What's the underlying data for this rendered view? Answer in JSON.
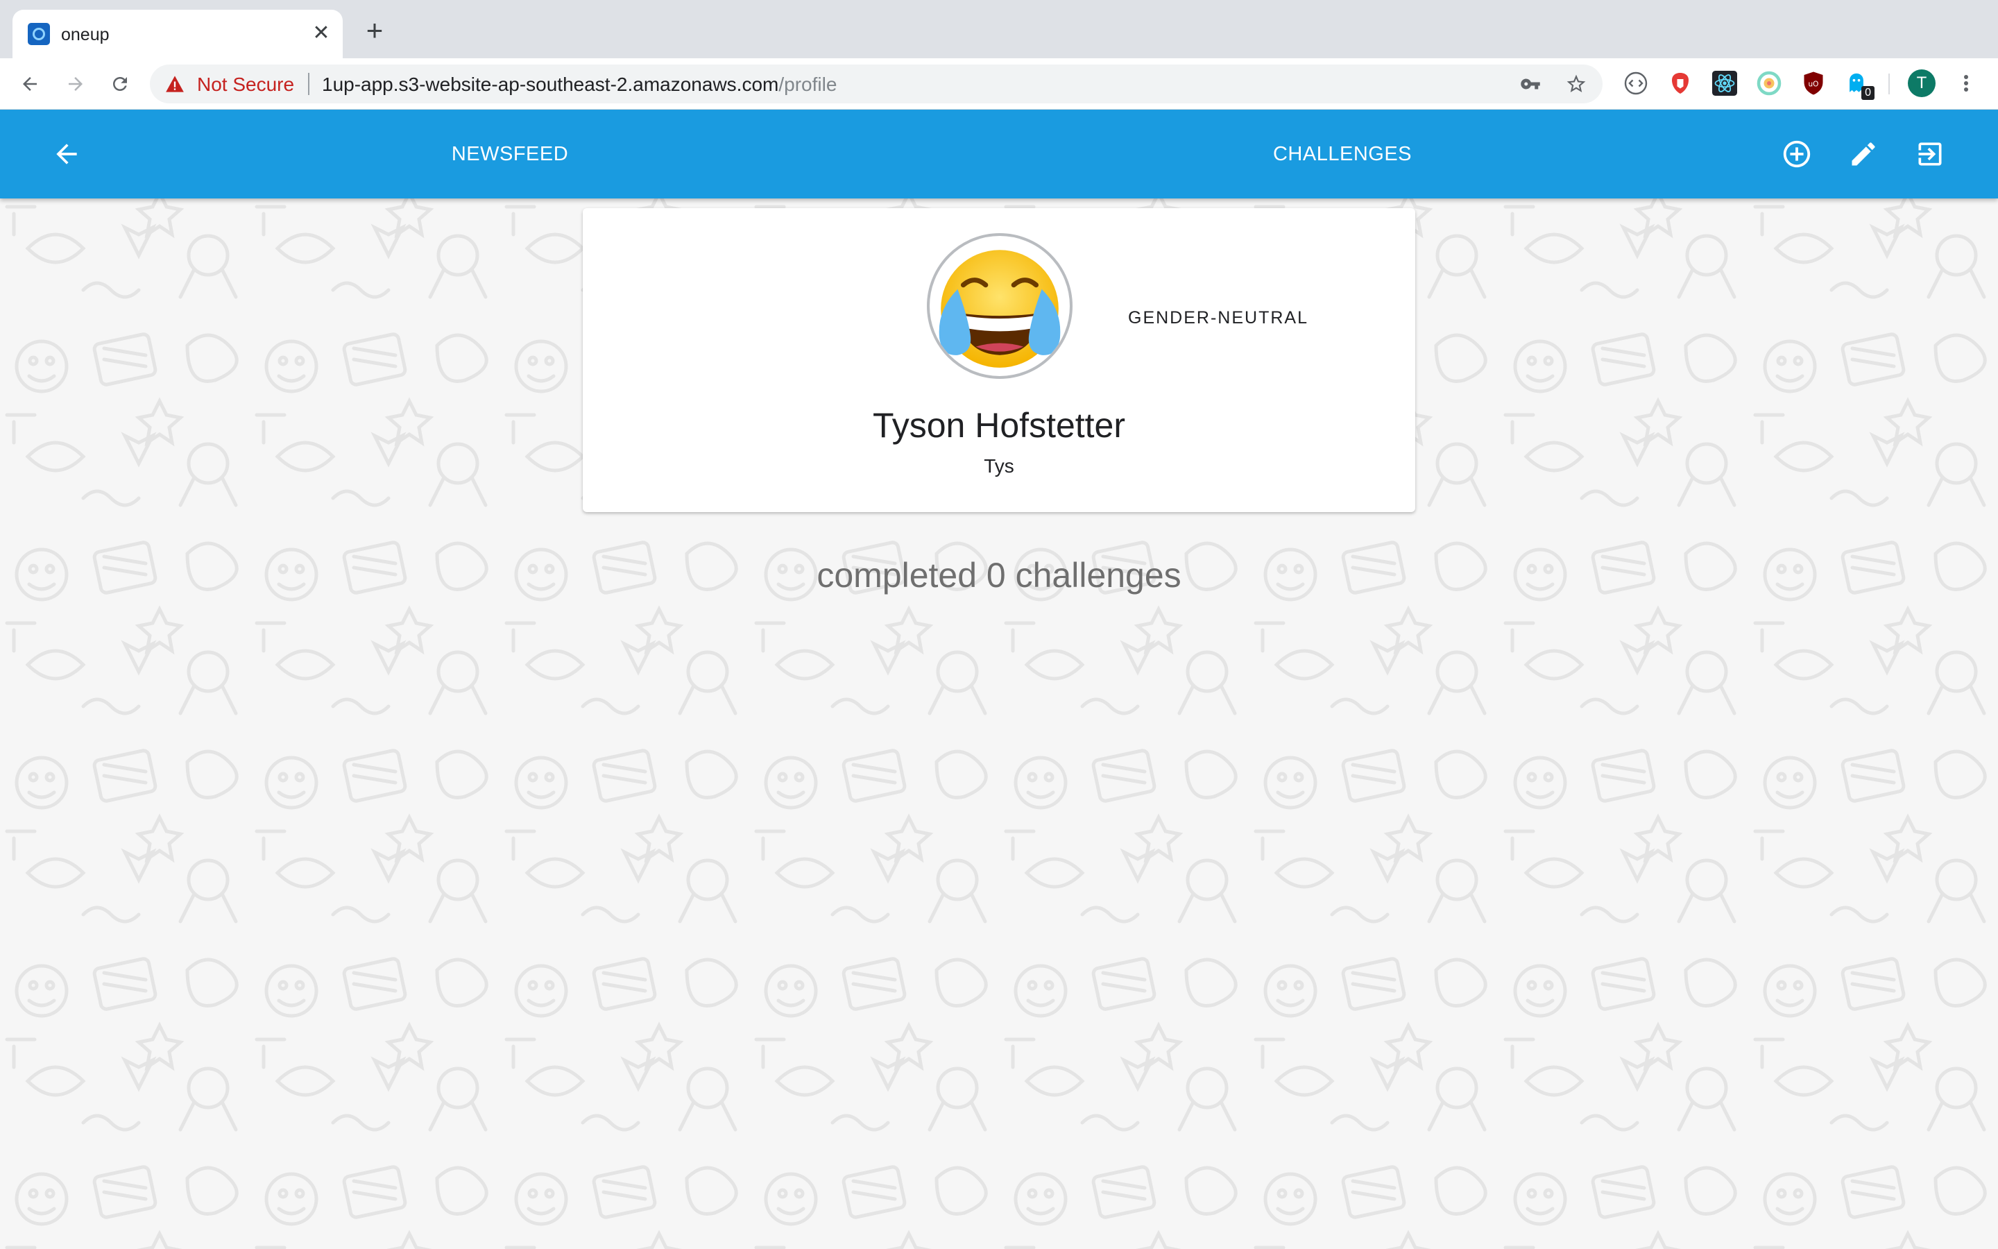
{
  "browser": {
    "tab": {
      "title": "oneup",
      "close_glyph": "✕"
    },
    "new_tab_glyph": "+",
    "address_bar": {
      "security_label": "Not Secure",
      "url_host": "1up-app.s3-website-ap-southeast-2.amazonaws.com",
      "url_path": "/profile"
    },
    "extensions": [
      {
        "name": "code-extension-icon"
      },
      {
        "name": "red-shield-extension-icon"
      },
      {
        "name": "react-devtools-icon"
      },
      {
        "name": "colorful-circle-extension-icon"
      },
      {
        "name": "ublock-origin-icon"
      },
      {
        "name": "ghostery-extension-icon",
        "badge": "0"
      }
    ],
    "profile_initial": "T"
  },
  "app": {
    "colors": {
      "appbar": "#1a9be0",
      "text_muted": "#6f6f6f"
    },
    "nav": {
      "newsfeed_label": "NEWSFEED",
      "challenges_label": "CHALLENGES"
    },
    "actions": [
      "add-circle-icon",
      "edit-pencil-icon",
      "exit-to-app-icon"
    ],
    "profile": {
      "avatar_icon": "face-with-tears-of-joy-icon",
      "gender": "GENDER-NEUTRAL",
      "name": "Tyson Hofstetter",
      "nickname": "Tys"
    },
    "stats_text": "completed 0 challenges"
  }
}
